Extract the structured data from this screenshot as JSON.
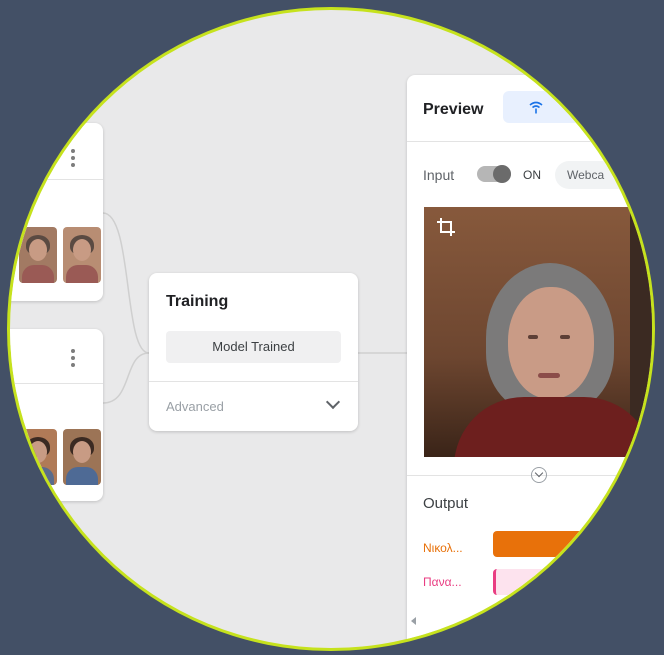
{
  "training": {
    "title": "Training",
    "status": "Model Trained",
    "advanced": "Advanced"
  },
  "preview": {
    "title": "Preview",
    "input_label": "Input",
    "toggle_label": "ON",
    "source": "Webca",
    "output_title": "Output",
    "classes": [
      {
        "label": "Νικολ...",
        "color": "#e8710a"
      },
      {
        "label": "Πανα...",
        "color": "#e93d82"
      }
    ]
  },
  "colors": {
    "accent_ring": "#c6e21d",
    "background": "#435066"
  }
}
